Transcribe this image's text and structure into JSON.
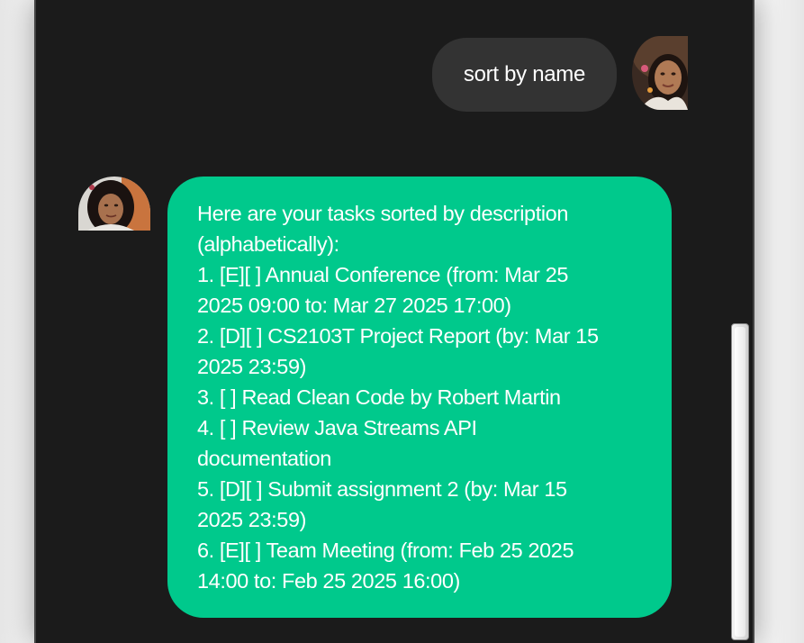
{
  "chat": {
    "user_message": "sort by name",
    "bot_message_lines": [
      "Here are your tasks sorted by description",
      "(alphabetically):",
      "1. [E][ ] Annual Conference (from: Mar 25",
      "2025 09:00 to: Mar 27 2025 17:00)",
      "2. [D][ ] CS2103T Project Report (by: Mar 15",
      "2025 23:59)",
      "3. [ ] Read Clean Code by Robert Martin",
      "4. [ ] Review Java Streams API",
      "documentation",
      "5. [D][ ] Submit assignment 2 (by: Mar 15",
      "2025 23:59)",
      "6. [E][ ] Team Meeting (from: Feb 25 2025",
      "14:00 to: Feb 25 2025 16:00)"
    ]
  },
  "colors": {
    "window_background": "#1b1b1b",
    "user_bubble": "#333333",
    "bot_bubble": "#00c98c",
    "text": "#ffffff"
  },
  "icons": {
    "user_avatar": "user-avatar-photo",
    "bot_avatar": "bot-avatar-photo"
  }
}
